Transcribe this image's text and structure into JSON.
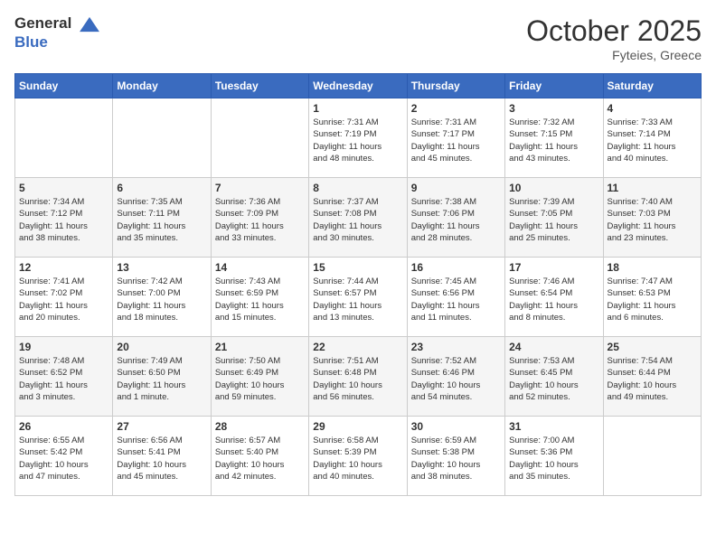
{
  "header": {
    "logo_line1": "General",
    "logo_line2": "Blue",
    "month_title": "October 2025",
    "location": "Fyteies, Greece"
  },
  "days_of_week": [
    "Sunday",
    "Monday",
    "Tuesday",
    "Wednesday",
    "Thursday",
    "Friday",
    "Saturday"
  ],
  "weeks": [
    [
      {
        "day": "",
        "info": ""
      },
      {
        "day": "",
        "info": ""
      },
      {
        "day": "",
        "info": ""
      },
      {
        "day": "1",
        "info": "Sunrise: 7:31 AM\nSunset: 7:19 PM\nDaylight: 11 hours\nand 48 minutes."
      },
      {
        "day": "2",
        "info": "Sunrise: 7:31 AM\nSunset: 7:17 PM\nDaylight: 11 hours\nand 45 minutes."
      },
      {
        "day": "3",
        "info": "Sunrise: 7:32 AM\nSunset: 7:15 PM\nDaylight: 11 hours\nand 43 minutes."
      },
      {
        "day": "4",
        "info": "Sunrise: 7:33 AM\nSunset: 7:14 PM\nDaylight: 11 hours\nand 40 minutes."
      }
    ],
    [
      {
        "day": "5",
        "info": "Sunrise: 7:34 AM\nSunset: 7:12 PM\nDaylight: 11 hours\nand 38 minutes."
      },
      {
        "day": "6",
        "info": "Sunrise: 7:35 AM\nSunset: 7:11 PM\nDaylight: 11 hours\nand 35 minutes."
      },
      {
        "day": "7",
        "info": "Sunrise: 7:36 AM\nSunset: 7:09 PM\nDaylight: 11 hours\nand 33 minutes."
      },
      {
        "day": "8",
        "info": "Sunrise: 7:37 AM\nSunset: 7:08 PM\nDaylight: 11 hours\nand 30 minutes."
      },
      {
        "day": "9",
        "info": "Sunrise: 7:38 AM\nSunset: 7:06 PM\nDaylight: 11 hours\nand 28 minutes."
      },
      {
        "day": "10",
        "info": "Sunrise: 7:39 AM\nSunset: 7:05 PM\nDaylight: 11 hours\nand 25 minutes."
      },
      {
        "day": "11",
        "info": "Sunrise: 7:40 AM\nSunset: 7:03 PM\nDaylight: 11 hours\nand 23 minutes."
      }
    ],
    [
      {
        "day": "12",
        "info": "Sunrise: 7:41 AM\nSunset: 7:02 PM\nDaylight: 11 hours\nand 20 minutes."
      },
      {
        "day": "13",
        "info": "Sunrise: 7:42 AM\nSunset: 7:00 PM\nDaylight: 11 hours\nand 18 minutes."
      },
      {
        "day": "14",
        "info": "Sunrise: 7:43 AM\nSunset: 6:59 PM\nDaylight: 11 hours\nand 15 minutes."
      },
      {
        "day": "15",
        "info": "Sunrise: 7:44 AM\nSunset: 6:57 PM\nDaylight: 11 hours\nand 13 minutes."
      },
      {
        "day": "16",
        "info": "Sunrise: 7:45 AM\nSunset: 6:56 PM\nDaylight: 11 hours\nand 11 minutes."
      },
      {
        "day": "17",
        "info": "Sunrise: 7:46 AM\nSunset: 6:54 PM\nDaylight: 11 hours\nand 8 minutes."
      },
      {
        "day": "18",
        "info": "Sunrise: 7:47 AM\nSunset: 6:53 PM\nDaylight: 11 hours\nand 6 minutes."
      }
    ],
    [
      {
        "day": "19",
        "info": "Sunrise: 7:48 AM\nSunset: 6:52 PM\nDaylight: 11 hours\nand 3 minutes."
      },
      {
        "day": "20",
        "info": "Sunrise: 7:49 AM\nSunset: 6:50 PM\nDaylight: 11 hours\nand 1 minute."
      },
      {
        "day": "21",
        "info": "Sunrise: 7:50 AM\nSunset: 6:49 PM\nDaylight: 10 hours\nand 59 minutes."
      },
      {
        "day": "22",
        "info": "Sunrise: 7:51 AM\nSunset: 6:48 PM\nDaylight: 10 hours\nand 56 minutes."
      },
      {
        "day": "23",
        "info": "Sunrise: 7:52 AM\nSunset: 6:46 PM\nDaylight: 10 hours\nand 54 minutes."
      },
      {
        "day": "24",
        "info": "Sunrise: 7:53 AM\nSunset: 6:45 PM\nDaylight: 10 hours\nand 52 minutes."
      },
      {
        "day": "25",
        "info": "Sunrise: 7:54 AM\nSunset: 6:44 PM\nDaylight: 10 hours\nand 49 minutes."
      }
    ],
    [
      {
        "day": "26",
        "info": "Sunrise: 6:55 AM\nSunset: 5:42 PM\nDaylight: 10 hours\nand 47 minutes."
      },
      {
        "day": "27",
        "info": "Sunrise: 6:56 AM\nSunset: 5:41 PM\nDaylight: 10 hours\nand 45 minutes."
      },
      {
        "day": "28",
        "info": "Sunrise: 6:57 AM\nSunset: 5:40 PM\nDaylight: 10 hours\nand 42 minutes."
      },
      {
        "day": "29",
        "info": "Sunrise: 6:58 AM\nSunset: 5:39 PM\nDaylight: 10 hours\nand 40 minutes."
      },
      {
        "day": "30",
        "info": "Sunrise: 6:59 AM\nSunset: 5:38 PM\nDaylight: 10 hours\nand 38 minutes."
      },
      {
        "day": "31",
        "info": "Sunrise: 7:00 AM\nSunset: 5:36 PM\nDaylight: 10 hours\nand 35 minutes."
      },
      {
        "day": "",
        "info": ""
      }
    ]
  ]
}
